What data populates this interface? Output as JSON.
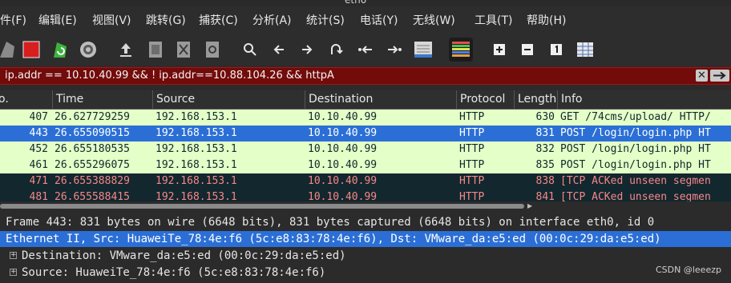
{
  "window": {
    "title": "eth0"
  },
  "menu": [
    "文件(F)",
    "编辑(E)",
    "视图(V)",
    "跳转(G)",
    "捕获(C)",
    "分析(A)",
    "统计(S)",
    "电话(Y)",
    "无线(W)",
    "工具(T)",
    "帮助(H)"
  ],
  "toolbar": {
    "icons": [
      "shark-fin-icon",
      "stop-capture-icon",
      "restart-capture-icon",
      "capture-options-icon",
      "open-file-icon",
      "save-file-icon",
      "close-file-icon",
      "reload-file-icon",
      "search-icon",
      "back-arrow-icon",
      "forward-arrow-icon",
      "go-to-packet-icon",
      "first-packet-icon",
      "last-packet-icon",
      "auto-scroll-icon",
      "colorize-icon",
      "zoom-in-icon",
      "zoom-out-icon",
      "normal-size-icon",
      "resize-columns-icon"
    ]
  },
  "filter": {
    "value": "ip.addr == 10.10.40.99 && ! ip.addr==10.88.104.26 && httpA"
  },
  "columns": [
    "o.",
    "Time",
    "Source",
    "Destination",
    "Protocol",
    "Length",
    "Info"
  ],
  "packets": [
    {
      "no": "407",
      "time": "26.627729259",
      "src": "192.168.153.1",
      "dst": "10.10.40.99",
      "proto": "HTTP",
      "len": "630",
      "info": "GET /74cms/upload/ HTTP/",
      "bg": "#e4ffc7",
      "fg": "#12272e"
    },
    {
      "no": "443",
      "time": "26.655090515",
      "src": "192.168.153.1",
      "dst": "10.10.40.99",
      "proto": "HTTP",
      "len": "831",
      "info": "POST /login/login.php HT",
      "bg": "#2b6fd6",
      "fg": "#ffffff"
    },
    {
      "no": "452",
      "time": "26.655180535",
      "src": "192.168.153.1",
      "dst": "10.10.40.99",
      "proto": "HTTP",
      "len": "832",
      "info": "POST /login/login.php HT",
      "bg": "#e4ffc7",
      "fg": "#12272e"
    },
    {
      "no": "461",
      "time": "26.655296075",
      "src": "192.168.153.1",
      "dst": "10.10.40.99",
      "proto": "HTTP",
      "len": "835",
      "info": "POST /login/login.php HT",
      "bg": "#e4ffc7",
      "fg": "#12272e"
    },
    {
      "no": "471",
      "time": "26.655388829",
      "src": "192.168.153.1",
      "dst": "10.10.40.99",
      "proto": "HTTP",
      "len": "838",
      "info": "[TCP ACKed unseen segmen",
      "bg": "#12272e",
      "fg": "#f78787"
    },
    {
      "no": "481",
      "time": "26.655588415",
      "src": "192.168.153.1",
      "dst": "10.10.40.99",
      "proto": "HTTP",
      "len": "841",
      "info": "[TCP ACKed unseen segmen",
      "bg": "#12272e",
      "fg": "#f78787"
    }
  ],
  "details": [
    {
      "text": "Frame 443: 831 bytes on wire (6648 bits), 831 bytes captured (6648 bits) on interface eth0, id 0",
      "expander": "none",
      "selected": false
    },
    {
      "text": "Ethernet II, Src: HuaweiTe_78:4e:f6 (5c:e8:83:78:4e:f6), Dst: VMware_da:e5:ed (00:0c:29:da:e5:ed)",
      "expander": "none",
      "selected": true
    },
    {
      "text": "Destination: VMware_da:e5:ed (00:0c:29:da:e5:ed)",
      "expander": "+",
      "selected": false
    },
    {
      "text": "Source: HuaweiTe_78:4e:f6 (5c:e8:83:78:4e:f6)",
      "expander": "+",
      "selected": false
    }
  ],
  "watermark": "CSDN @leeezp",
  "colors": {
    "selection": "#2b6fd6",
    "filter_bg": "#730b0b",
    "http_row": "#e4ffc7",
    "bad_tcp_row": "#12272e"
  }
}
